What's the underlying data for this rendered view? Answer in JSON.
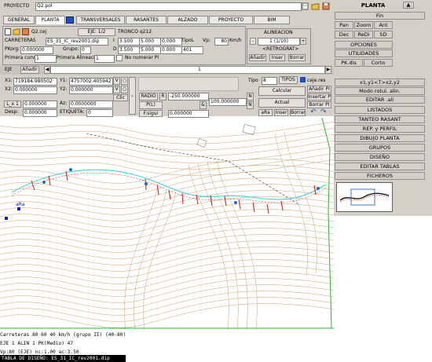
{
  "project": {
    "label": "PROYECTO",
    "file": "Q2.pol"
  },
  "tabs": [
    "GENERAL",
    "PLANTA",
    "TRANSVERSALES",
    "RASANTES",
    "ALZADO",
    "PROYECTO",
    "BIM"
  ],
  "road": {
    "file_label": "Q2.cej",
    "eje_label": "EJE: 1/2",
    "tronco_label": "TRONCO q212",
    "carreteras_label": "CARRETERAS",
    "dip_file": "ES_31_IC_rev2001.dip",
    "pk_label": "PKorg:",
    "pk_value": "0.000000",
    "grupo_label": "Grupo:",
    "grupo_value": "0",
    "i_label": "I",
    "i_val1": "3.500",
    "i_val2": "5.000",
    "i_val3": "0.000",
    "tipol_label": "TipoL",
    "vp_label": "Vp:",
    "vp_value": "80",
    "vp_unit": "Km/h",
    "d_label": "D",
    "d_val1": "3.500",
    "d_val2": "5.000",
    "d_val3": "0.000",
    "d_val4": "401",
    "primera_curva_label": "Primera curva",
    "primera_curva_value": "1",
    "primera_alineacion_label": "Primera Alineación",
    "primera_alineacion_value": "1",
    "no_numerar_label": "No numerar PI"
  },
  "alineacion": {
    "title": "ALINEACION",
    "minus": "-",
    "plus": "+",
    "counter": "1 (1/10)",
    "retrograt": "<RETROGRAT>",
    "add": "Añadir",
    "insert": "Inser",
    "delete": "Borrar"
  },
  "eje_bar": {
    "label": "EJE",
    "add": "Añadir",
    "index": "1"
  },
  "coords": {
    "x1_label": "X1:",
    "x1_value": "719184.980502",
    "y1_label": "Y1:",
    "y1_value": "4757002.405942",
    "x2_label": "X2:",
    "x2_value": "0.000000",
    "y2_label": "Y2:",
    "y2_value": "0.000000",
    "v_label": "V",
    "clic_label": "Clic",
    "l_label": "L_x 1",
    "l_value": "0.000000",
    "az_label": "Az:",
    "az_value": "0.0000000",
    "desp_label": "Desp:",
    "desp_value": "0.000000",
    "etiqueta_label": "ETIQUETA:",
    "etiqueta_value": "0",
    "radio_label": "RADIO",
    "r_label": "R",
    "radio_value": "-250.000000",
    "p_label": "P(L)",
    "fsigui_label": "F.sigui",
    "fsigui_value": "0.000000",
    "value_100": "100.000000",
    "n_label": "N"
  },
  "tipo": {
    "label": "Tipo",
    "value": "8",
    "tipos_button": "TIPOS",
    "ceje_label": "ceje.res",
    "calcular": "Calcular",
    "actual": "Actual",
    "anadir_pi": "Añadir PI",
    "insertar_pi": "Insertar PI",
    "borrar_pi": "Borrar PI",
    "arai": "aRa",
    "inser": "Inser",
    "borrar": "Borrar"
  },
  "right_panel": {
    "title": "PLANTA",
    "fin": "Fin",
    "pan": "Pan",
    "zoom": "Zoom",
    "ant": "Ant",
    "dec": "Dec",
    "redi": "ReDi",
    "sd": "SD",
    "menu1": [
      "OPCIONES",
      "UTILIDADES"
    ],
    "pkdis": "PK.dis",
    "corto": "Corto",
    "menu2": [
      "x1,y1<T>x2,y2",
      "Modo rotul. alin.",
      "EDITAR .ali",
      "LISTADOS",
      "TANTEO RASANT",
      "REP. y PERFIL",
      "DIBUJO PLANTA",
      "GRUPOS",
      "DISEÑO",
      "EDITAR TABLAS",
      "FICHEROS"
    ]
  },
  "map": {
    "marker_label": "aRa"
  },
  "status_lines": [
    "Carreteras 80 60 40 km/h (grupo II) (40-80)",
    "EJE 1 ALIN 1 PK(Medio) 47",
    "Vp:80 (EJE) nc:1.00 ac:3.50",
    "TABLA DE DISEÑO: ES_31_IC_rev2001.dip"
  ],
  "colors": {
    "panel": "#d4d0c8",
    "contour_brown": "#c8a26a",
    "alignment_red": "#e02020",
    "road_cyan": "#3cd0e0",
    "boundary_green": "#30b030"
  }
}
